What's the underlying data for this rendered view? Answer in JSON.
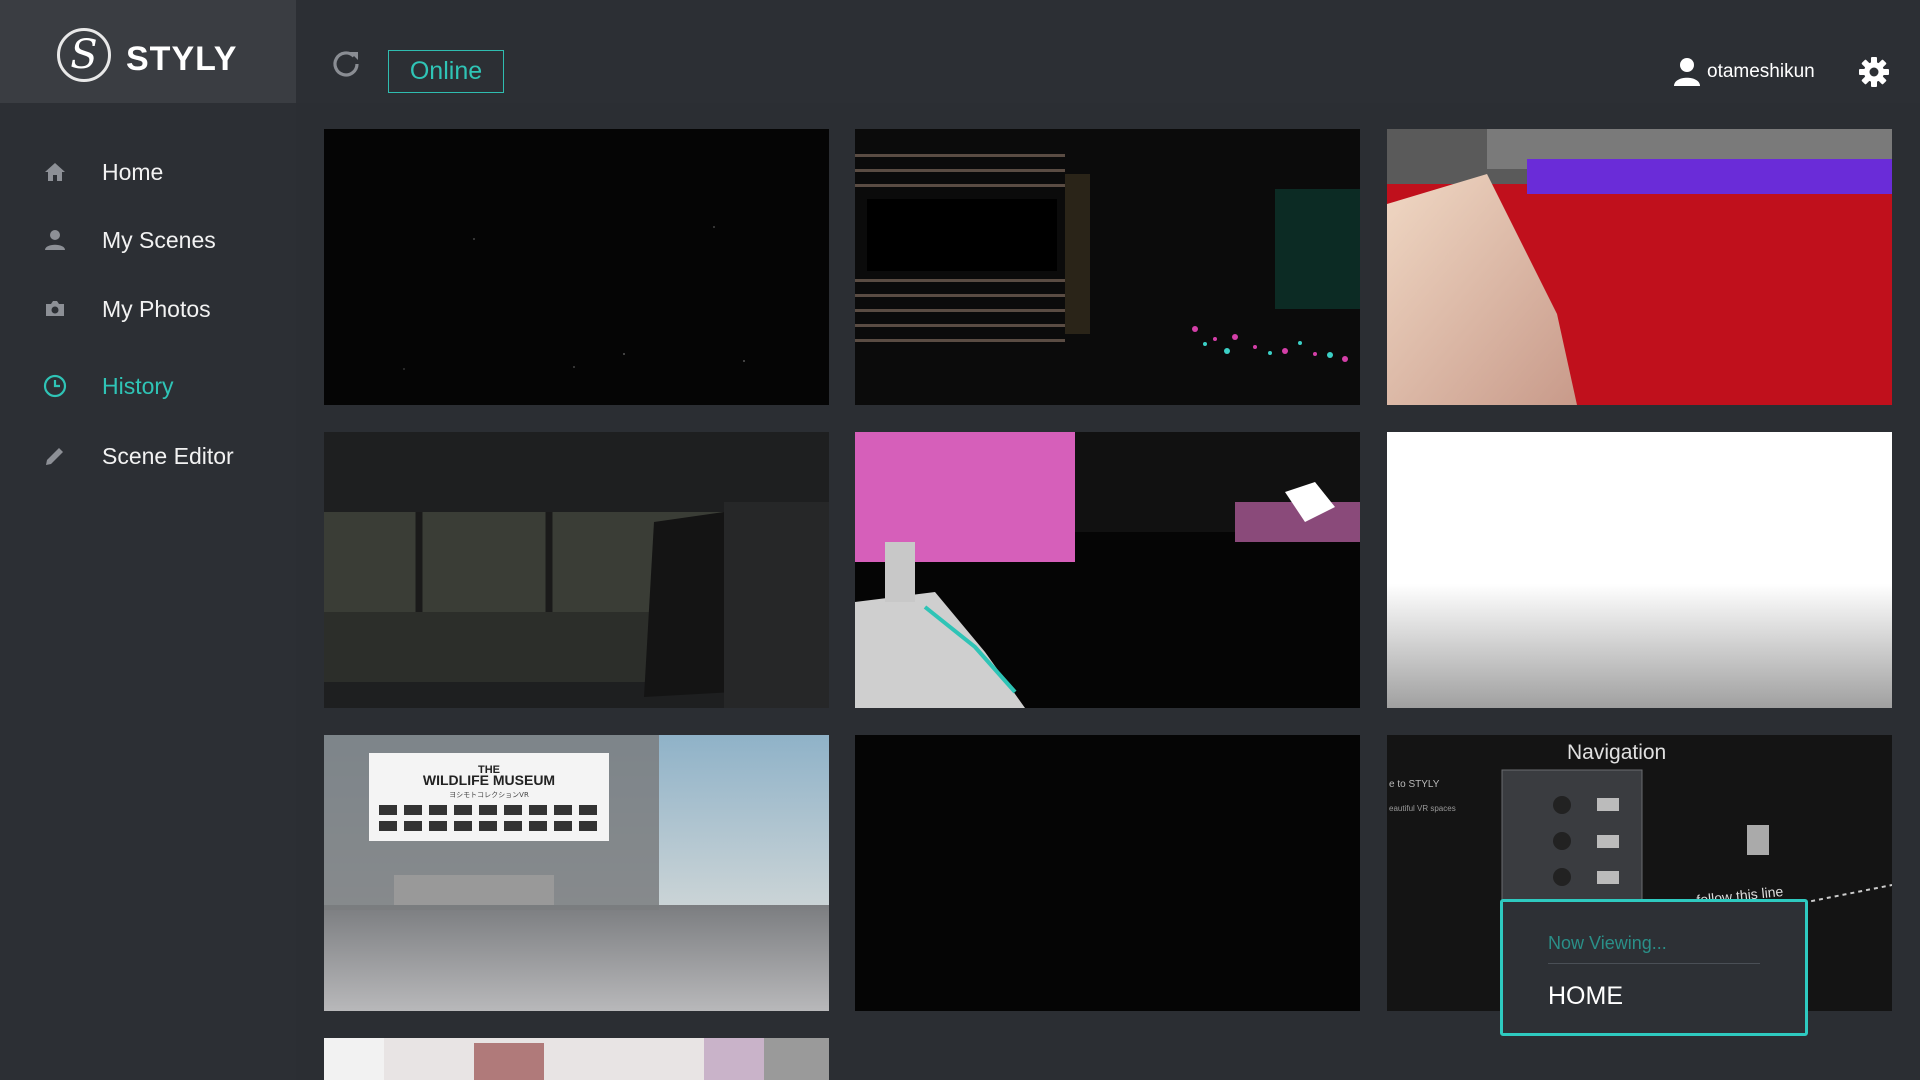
{
  "app": {
    "name": "STYLY",
    "logo_letter": "S"
  },
  "sidebar": {
    "items": [
      {
        "label": "Home",
        "icon": "home-icon",
        "active": false
      },
      {
        "label": "My Scenes",
        "icon": "person-icon",
        "active": false
      },
      {
        "label": "My Photos",
        "icon": "camera-icon",
        "active": false
      },
      {
        "label": "History",
        "icon": "clock-icon",
        "active": true
      },
      {
        "label": "Scene Editor",
        "icon": "pencil-icon",
        "active": false
      }
    ]
  },
  "topbar": {
    "status": "Online",
    "username": "otameshikun",
    "refresh_icon": "refresh-icon",
    "settings_icon": "gear-icon"
  },
  "thumbnails": {
    "text": {
      "museum_title": "THE",
      "museum_name": "WILDLIFE MUSEUM",
      "museum_sub": "ヨシモトコレクションVR",
      "nav_title": "Navigation",
      "nav_left_1": "e to STYLY",
      "nav_left_2": "eautiful VR spaces",
      "nav_follow": "follow this line"
    }
  },
  "now_viewing": {
    "label": "Now Viewing...",
    "value": "HOME"
  },
  "colors": {
    "accent": "#2fc4b6",
    "sidebar_bg": "#2c2f34",
    "logo_bar_bg": "#3a3d42",
    "content_bg": "#2b2e33"
  }
}
